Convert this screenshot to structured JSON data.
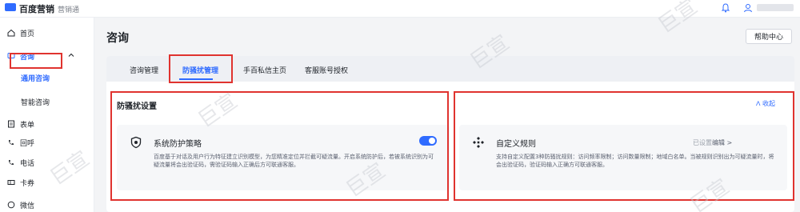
{
  "header": {
    "logo_text": "百度营销",
    "logo_sub": "营销通"
  },
  "sidebar": {
    "items": [
      {
        "label": "首页",
        "icon": "home-icon"
      },
      {
        "label": "咨询",
        "icon": "chat-icon"
      },
      {
        "label": "通用咨询"
      },
      {
        "label": "智能咨询"
      },
      {
        "label": "表单",
        "icon": "form-icon"
      },
      {
        "label": "回呼",
        "icon": "callback-icon"
      },
      {
        "label": "电话",
        "icon": "phone-icon"
      },
      {
        "label": "卡券",
        "icon": "coupon-icon"
      },
      {
        "label": "微信",
        "icon": "wechat-icon"
      }
    ]
  },
  "main": {
    "title": "咨询",
    "help_label": "帮助中心",
    "tabs": [
      {
        "label": "咨询管理"
      },
      {
        "label": "防骚扰管理"
      },
      {
        "label": "手百私信主页"
      },
      {
        "label": "客服账号授权"
      }
    ],
    "section_title": "防骚扰设置",
    "collapse_label": "收起",
    "panels": [
      {
        "title": "系统防护策略",
        "description": "百度基于对话及用户行为特征建立识别模型，为您精准定位并拦截可疑流量。开启系统防护后，若被系统识别为可疑流量将会出验证码，需验证码输入正确后方可联通客服。",
        "toggle_on": true
      },
      {
        "title": "自定义规则",
        "status": "已设置",
        "edit_label": "编辑 >",
        "description": "支持自定义配置3种防骚扰规则：访问频率限制；访问数量限制；地域白名单。当被规则识别出为可疑流量时，将会出验证码，验证码输入正确方可联通客服。"
      }
    ]
  },
  "watermark": "巨宣",
  "colors": {
    "accent": "#2f6bff",
    "highlight_box": "#e0332f"
  }
}
